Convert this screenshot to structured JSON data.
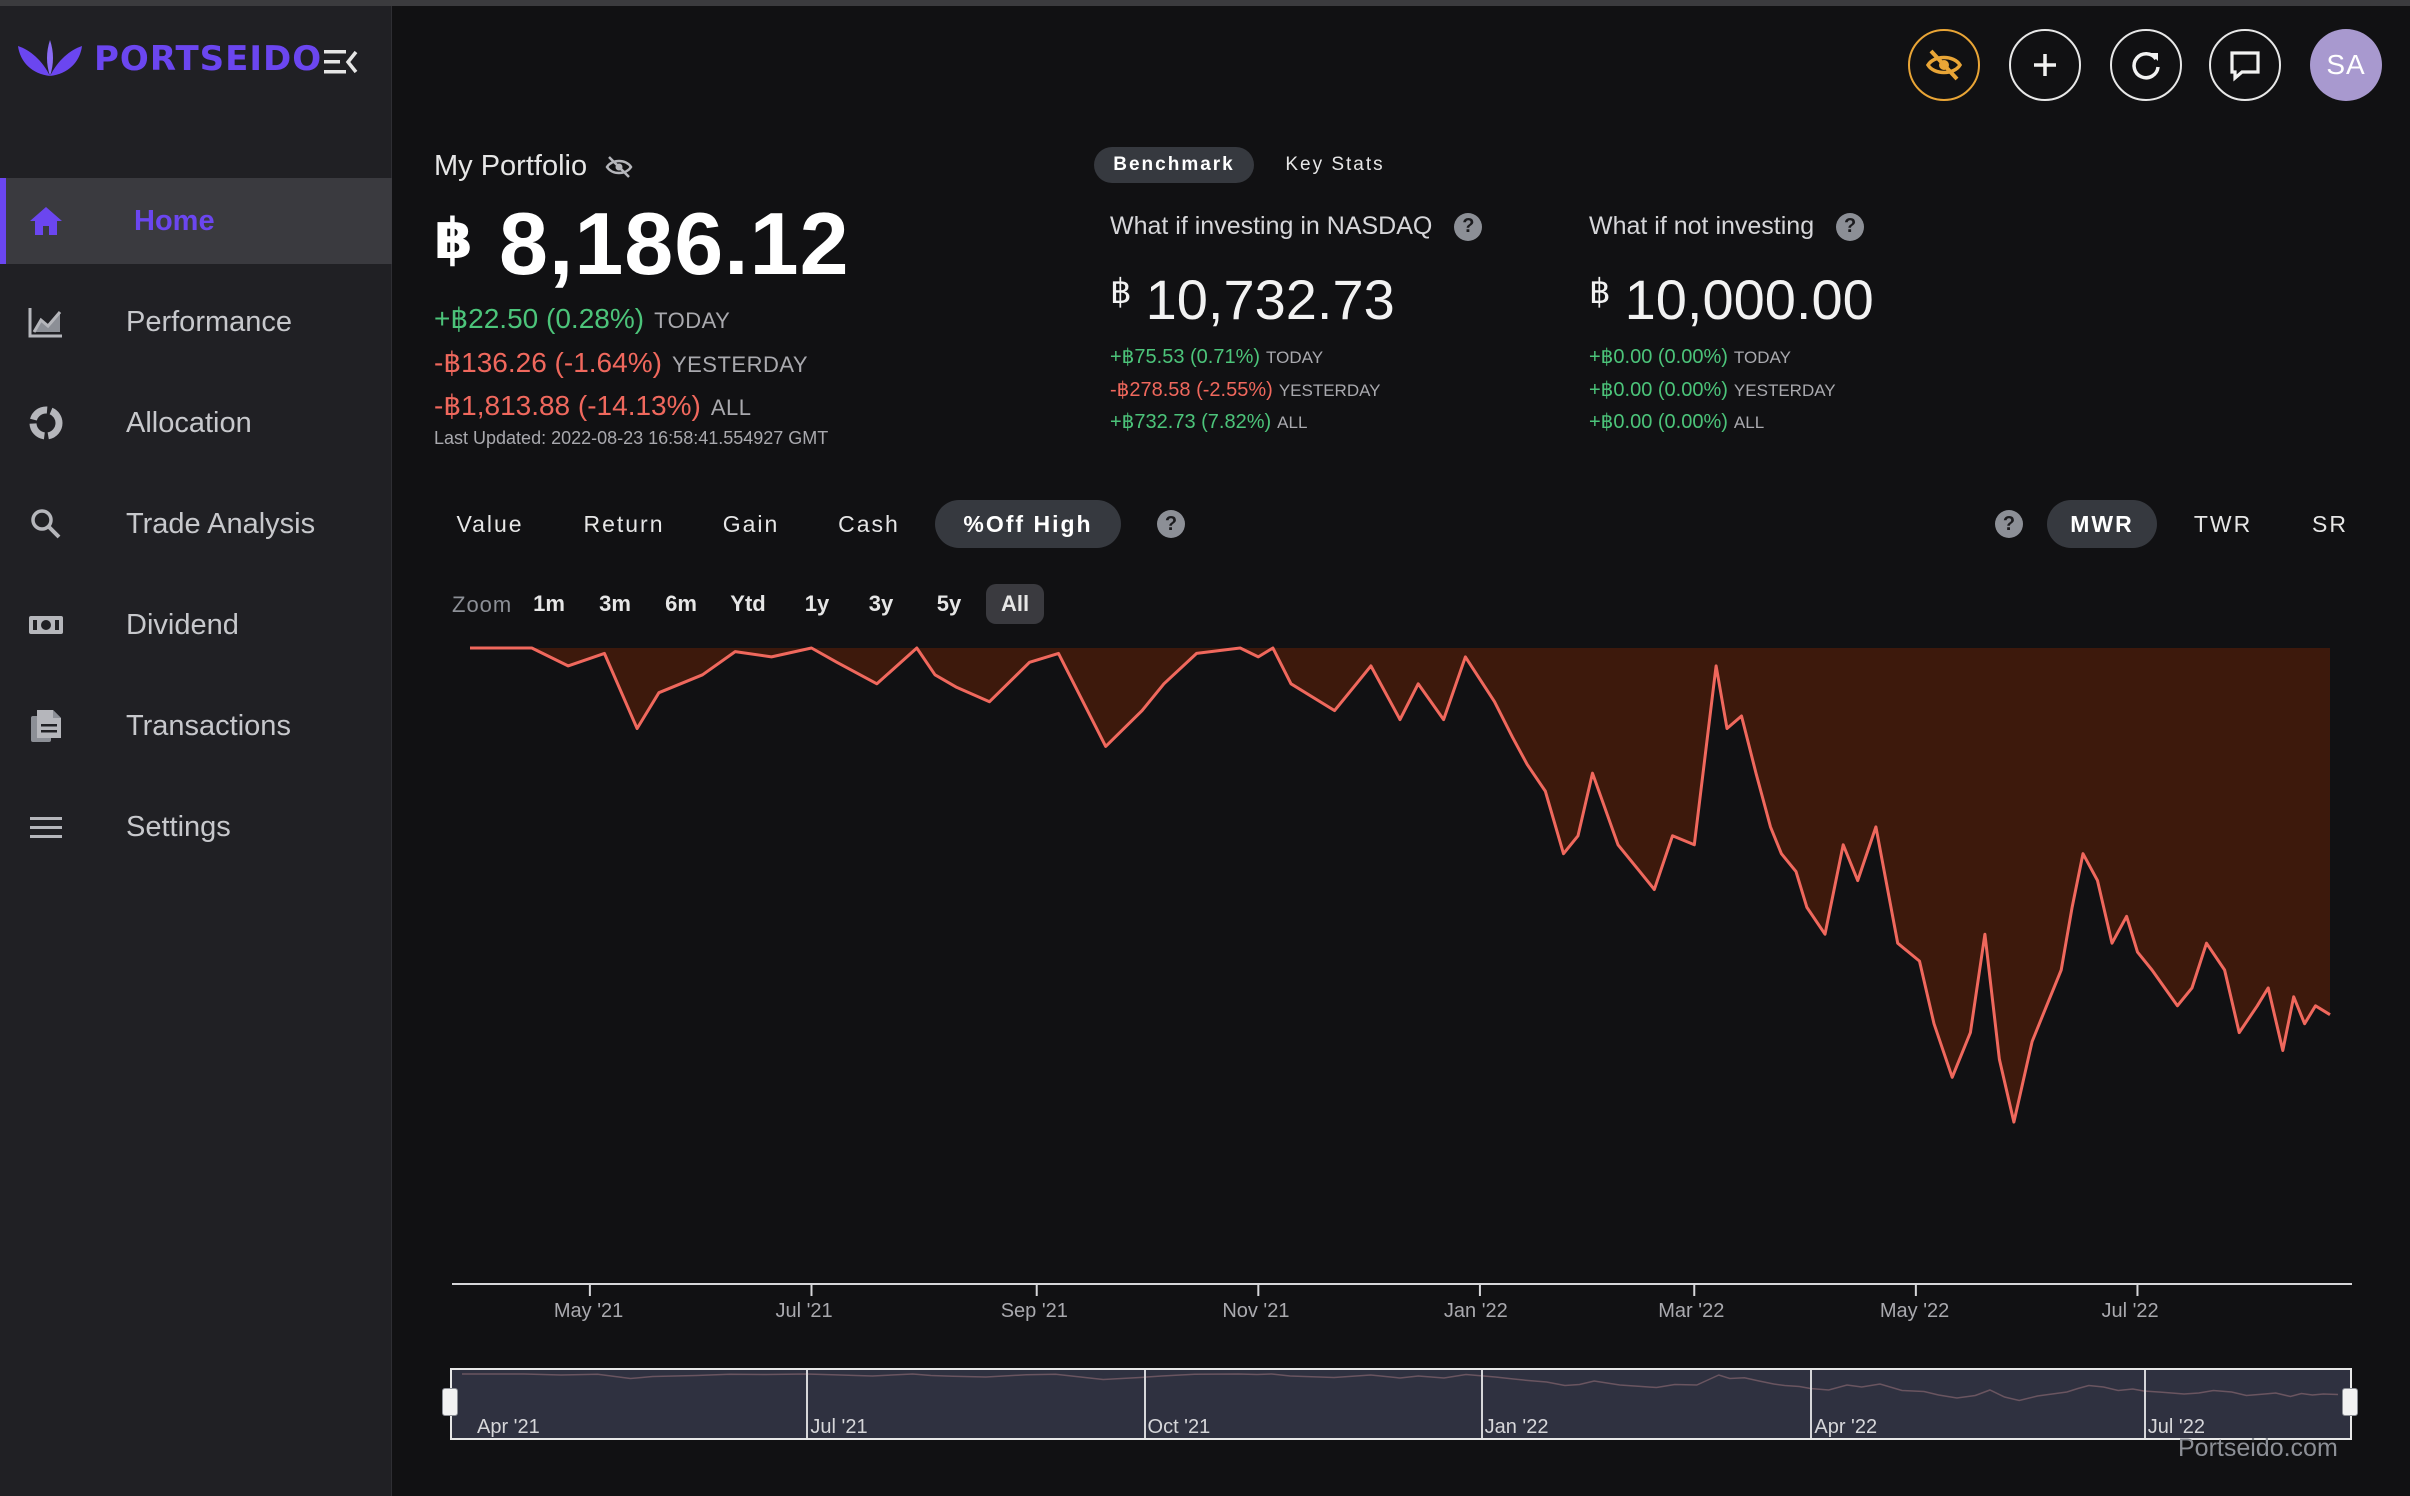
{
  "brand": {
    "name": "PORTSEIDO"
  },
  "sidebar": {
    "items": [
      {
        "label": "Home",
        "icon": "home-icon",
        "active": true
      },
      {
        "label": "Performance",
        "icon": "chart-icon",
        "active": false
      },
      {
        "label": "Allocation",
        "icon": "pie-icon",
        "active": false
      },
      {
        "label": "Trade Analysis",
        "icon": "search-icon",
        "active": false
      },
      {
        "label": "Dividend",
        "icon": "cash-icon",
        "active": false
      },
      {
        "label": "Transactions",
        "icon": "document-icon",
        "active": false
      },
      {
        "label": "Settings",
        "icon": "menu-icon",
        "active": false
      }
    ]
  },
  "header": {
    "buttons": [
      "hide-values-icon",
      "add-icon",
      "refresh-icon",
      "feedback-icon"
    ],
    "avatar_initials": "SA"
  },
  "portfolio": {
    "title": "My Portfolio",
    "currency": "฿",
    "value": "8,186.12",
    "changes": [
      {
        "text": "+฿22.50 (0.28%)",
        "label": "TODAY",
        "tone": "green"
      },
      {
        "text": "-฿136.26 (-1.64%)",
        "label": "YESTERDAY",
        "tone": "red"
      },
      {
        "text": "-฿1,813.88 (-14.13%)",
        "label": "ALL",
        "tone": "red"
      }
    ],
    "last_updated": "Last Updated: 2022-08-23 16:58:41.554927 GMT"
  },
  "benchmark": {
    "tabs": [
      "Benchmark",
      "Key Stats"
    ],
    "cards": [
      {
        "title": "What if investing in NASDAQ",
        "currency": "฿",
        "value": "10,732.73",
        "changes": [
          {
            "text": "+฿75.53 (0.71%)",
            "label": "TODAY",
            "tone": "green"
          },
          {
            "text": "-฿278.58 (-2.55%)",
            "label": "YESTERDAY",
            "tone": "red"
          },
          {
            "text": "+฿732.73 (7.82%)",
            "label": "ALL",
            "tone": "green"
          }
        ]
      },
      {
        "title": "What if not investing",
        "currency": "฿",
        "value": "10,000.00",
        "changes": [
          {
            "text": "+฿0.00 (0.00%)",
            "label": "TODAY",
            "tone": "green"
          },
          {
            "text": "+฿0.00 (0.00%)",
            "label": "YESTERDAY",
            "tone": "green"
          },
          {
            "text": "+฿0.00 (0.00%)",
            "label": "ALL",
            "tone": "green"
          }
        ]
      }
    ]
  },
  "chart_tabs": {
    "items": [
      "Value",
      "Return",
      "Gain",
      "Cash",
      "%Off High"
    ],
    "active": "%Off High"
  },
  "method_tabs": {
    "items": [
      "MWR",
      "TWR",
      "SR"
    ],
    "active": "MWR"
  },
  "zoom": {
    "label": "Zoom",
    "options": [
      "1m",
      "3m",
      "6m",
      "Ytd",
      "1y",
      "3y",
      "5y",
      "All"
    ],
    "active": "All"
  },
  "colors": {
    "accent": "#6b46f0",
    "line": "#f0685d",
    "fill": "#3d190c",
    "positive": "#4cc47a",
    "negative": "#f0685d",
    "hide_button": "#e9a536"
  },
  "chart_data": {
    "type": "area",
    "title": "",
    "xlabel": "",
    "ylabel": "",
    "x_ticks": [
      "May '21",
      "Jul '21",
      "Sep '21",
      "Nov '21",
      "Jan '22",
      "Mar '22",
      "May '22",
      "Jul '22"
    ],
    "x_range": [
      "2021-03-29",
      "2022-08-23"
    ],
    "ylim": [
      -36,
      0
    ],
    "series": [
      {
        "points": [
          [
            "2021-03-29",
            0
          ],
          [
            "2021-04-15",
            0
          ],
          [
            "2021-04-25",
            -1.0
          ],
          [
            "2021-05-05",
            -0.3
          ],
          [
            "2021-05-14",
            -4.5
          ],
          [
            "2021-05-20",
            -2.5
          ],
          [
            "2021-06-01",
            -1.5
          ],
          [
            "2021-06-10",
            -0.2
          ],
          [
            "2021-06-20",
            -0.5
          ],
          [
            "2021-07-01",
            0
          ],
          [
            "2021-07-08",
            -0.8
          ],
          [
            "2021-07-19",
            -2.0
          ],
          [
            "2021-07-30",
            0
          ],
          [
            "2021-08-04",
            -1.5
          ],
          [
            "2021-08-10",
            -2.2
          ],
          [
            "2021-08-19",
            -3.0
          ],
          [
            "2021-08-30",
            -0.8
          ],
          [
            "2021-09-07",
            -0.3
          ],
          [
            "2021-09-20",
            -5.5
          ],
          [
            "2021-09-30",
            -3.5
          ],
          [
            "2021-10-06",
            -2.0
          ],
          [
            "2021-10-15",
            -0.3
          ],
          [
            "2021-10-27",
            0
          ],
          [
            "2021-11-01",
            -0.5
          ],
          [
            "2021-11-05",
            0
          ],
          [
            "2021-11-10",
            -2.0
          ],
          [
            "2021-11-22",
            -3.5
          ],
          [
            "2021-11-28",
            -2.0
          ],
          [
            "2021-12-02",
            -1.0
          ],
          [
            "2021-12-10",
            -4.0
          ],
          [
            "2021-12-15",
            -2.0
          ],
          [
            "2021-12-22",
            -4.0
          ],
          [
            "2021-12-28",
            -0.5
          ],
          [
            "2022-01-05",
            -3.0
          ],
          [
            "2022-01-10",
            -5.0
          ],
          [
            "2022-01-14",
            -6.5
          ],
          [
            "2022-01-19",
            -8.0
          ],
          [
            "2022-01-24",
            -11.5
          ],
          [
            "2022-01-28",
            -10.5
          ],
          [
            "2022-02-01",
            -7.0
          ],
          [
            "2022-02-08",
            -11.0
          ],
          [
            "2022-02-14",
            -12.5
          ],
          [
            "2022-02-18",
            -13.5
          ],
          [
            "2022-02-23",
            -10.5
          ],
          [
            "2022-03-01",
            -11.0
          ],
          [
            "2022-03-07",
            -1.0
          ],
          [
            "2022-03-10",
            -4.5
          ],
          [
            "2022-03-14",
            -3.8
          ],
          [
            "2022-03-18",
            -7.0
          ],
          [
            "2022-03-22",
            -10.0
          ],
          [
            "2022-03-25",
            -11.5
          ],
          [
            "2022-03-29",
            -12.5
          ],
          [
            "2022-04-01",
            -14.5
          ],
          [
            "2022-04-06",
            -16.0
          ],
          [
            "2022-04-11",
            -11.0
          ],
          [
            "2022-04-15",
            -13.0
          ],
          [
            "2022-04-20",
            -10.0
          ],
          [
            "2022-04-26",
            -16.5
          ],
          [
            "2022-05-02",
            -17.5
          ],
          [
            "2022-05-06",
            -21.0
          ],
          [
            "2022-05-11",
            -24.0
          ],
          [
            "2022-05-16",
            -21.5
          ],
          [
            "2022-05-20",
            -16.0
          ],
          [
            "2022-05-24",
            -23.0
          ],
          [
            "2022-05-28",
            -26.5
          ],
          [
            "2022-06-02",
            -22.0
          ],
          [
            "2022-06-06",
            -20.0
          ],
          [
            "2022-06-10",
            -18.0
          ],
          [
            "2022-06-13",
            -14.5
          ],
          [
            "2022-06-16",
            -11.5
          ],
          [
            "2022-06-20",
            -13.0
          ],
          [
            "2022-06-24",
            -16.5
          ],
          [
            "2022-06-28",
            -15.0
          ],
          [
            "2022-07-01",
            -17.0
          ],
          [
            "2022-07-05",
            -18.0
          ],
          [
            "2022-07-12",
            -20.0
          ],
          [
            "2022-07-16",
            -19.0
          ],
          [
            "2022-07-20",
            -16.5
          ],
          [
            "2022-07-25",
            -18.0
          ],
          [
            "2022-07-29",
            -21.5
          ],
          [
            "2022-08-03",
            -20.0
          ],
          [
            "2022-08-06",
            -19.0
          ],
          [
            "2022-08-10",
            -22.5
          ],
          [
            "2022-08-13",
            -19.5
          ],
          [
            "2022-08-16",
            -21.0
          ],
          [
            "2022-08-19",
            -20.0
          ],
          [
            "2022-08-23",
            -20.5
          ]
        ]
      }
    ],
    "navigator_ticks": [
      "Apr '21",
      "Jul '21",
      "Oct '21",
      "Jan '22",
      "Apr '22",
      "Jul '22"
    ],
    "credit": "Portseido.com",
    "grid": false,
    "legend": "none"
  }
}
